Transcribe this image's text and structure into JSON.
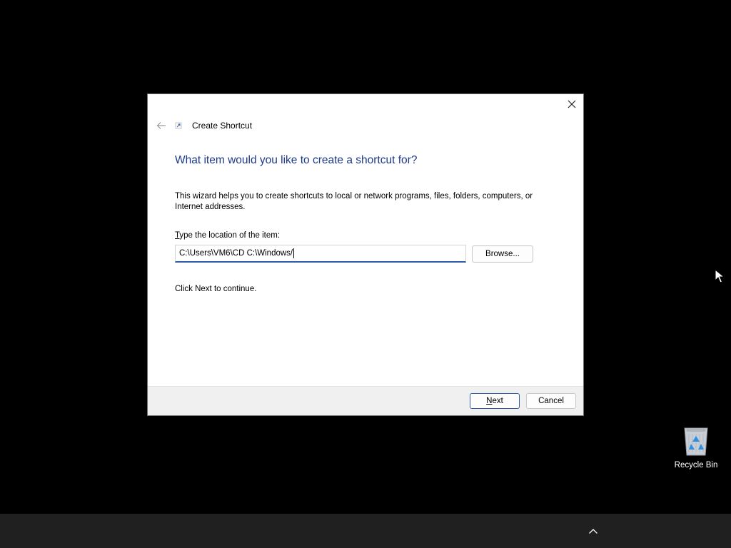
{
  "dialog": {
    "window_title": "Create Shortcut",
    "heading": "What item would you like to create a shortcut for?",
    "description": "This wizard helps you to create shortcuts to local or network programs, files, folders, computers, or Internet addresses.",
    "location_label_access_key": "T",
    "location_label_rest": "ype the location of the item:",
    "location_value": "C:\\Users\\VM6\\CD C:\\Windows/",
    "browse_label": "Browse...",
    "continue_text": "Click Next to continue.",
    "next_access_key": "N",
    "next_rest": "ext",
    "cancel_label": "Cancel"
  },
  "desktop": {
    "recycle_bin_label": "Recycle Bin"
  },
  "colors": {
    "heading": "#1d3a8a",
    "focus_accent": "#2d5ca8",
    "taskbar": "#202020",
    "desktop": "#000000"
  },
  "icons": {
    "back": "back-arrow-icon",
    "close": "close-icon",
    "wizard": "shortcut-wizard-icon",
    "recycle_bin": "recycle-bin-icon",
    "tray": "chevron-up-icon",
    "cursor": "mouse-pointer-icon"
  }
}
